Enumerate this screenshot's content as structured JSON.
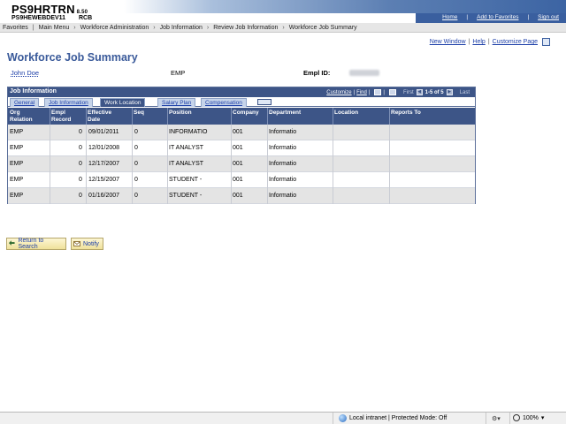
{
  "header": {
    "app_name": "PS9HRTRN",
    "version": "8.50",
    "db_name": "PS9HEWEBDEV11",
    "db_suffix": "RCB",
    "links": [
      "Home",
      "Add to Favorites",
      "Sign out"
    ]
  },
  "nav": {
    "crumbs": [
      "Favorites",
      "Main Menu",
      "Workforce Administration",
      "Job Information",
      "Review Job Information",
      "Workforce Job Summary"
    ]
  },
  "page_links": {
    "new_window": "New Window",
    "help": "Help",
    "customize": "Customize Page"
  },
  "page_title": "Workforce Job Summary",
  "employee": {
    "name": "John Doe",
    "type": "EMP",
    "emplid_label": "Empl ID:"
  },
  "grid": {
    "title": "Job Information",
    "customize": "Customize",
    "find": "Find",
    "first": "First",
    "count": "1-5 of 5",
    "last": "Last",
    "tabs": [
      "General",
      "Job Information",
      "Work Location",
      "Salary Plan",
      "Compensation"
    ],
    "active_tab": "Work Location",
    "columns": [
      {
        "l1": "Org",
        "l2": "Relation"
      },
      {
        "l1": "Empl",
        "l2": "Record"
      },
      {
        "l1": "Effective",
        "l2": "Date"
      },
      {
        "l1": "Seq",
        "l2": ""
      },
      {
        "l1": "Position",
        "l2": ""
      },
      {
        "l1": "Company",
        "l2": ""
      },
      {
        "l1": "Department",
        "l2": ""
      },
      {
        "l1": "Location",
        "l2": ""
      },
      {
        "l1": "Reports To",
        "l2": ""
      }
    ],
    "rows": [
      {
        "org": "EMP",
        "rec": "0",
        "date": "09/01/2011",
        "seq": "0",
        "position": "INFORMATIO",
        "company": "001",
        "dept": "Informatio",
        "location": "",
        "reports": ""
      },
      {
        "org": "EMP",
        "rec": "0",
        "date": "12/01/2008",
        "seq": "0",
        "position": "IT ANALYST",
        "company": "001",
        "dept": "Informatio",
        "location": "",
        "reports": ""
      },
      {
        "org": "EMP",
        "rec": "0",
        "date": "12/17/2007",
        "seq": "0",
        "position": "IT ANALYST",
        "company": "001",
        "dept": "Informatio",
        "location": "",
        "reports": ""
      },
      {
        "org": "EMP",
        "rec": "0",
        "date": "12/15/2007",
        "seq": "0",
        "position": "STUDENT -",
        "company": "001",
        "dept": "Informatio",
        "location": "",
        "reports": ""
      },
      {
        "org": "EMP",
        "rec": "0",
        "date": "01/16/2007",
        "seq": "0",
        "position": "STUDENT -",
        "company": "001",
        "dept": "Informatio",
        "location": "",
        "reports": ""
      }
    ]
  },
  "buttons": {
    "return": "Return to Search",
    "notify": "Notify"
  },
  "status": {
    "zone": "Local intranet | Protected Mode: Off",
    "zoom": "100%"
  }
}
